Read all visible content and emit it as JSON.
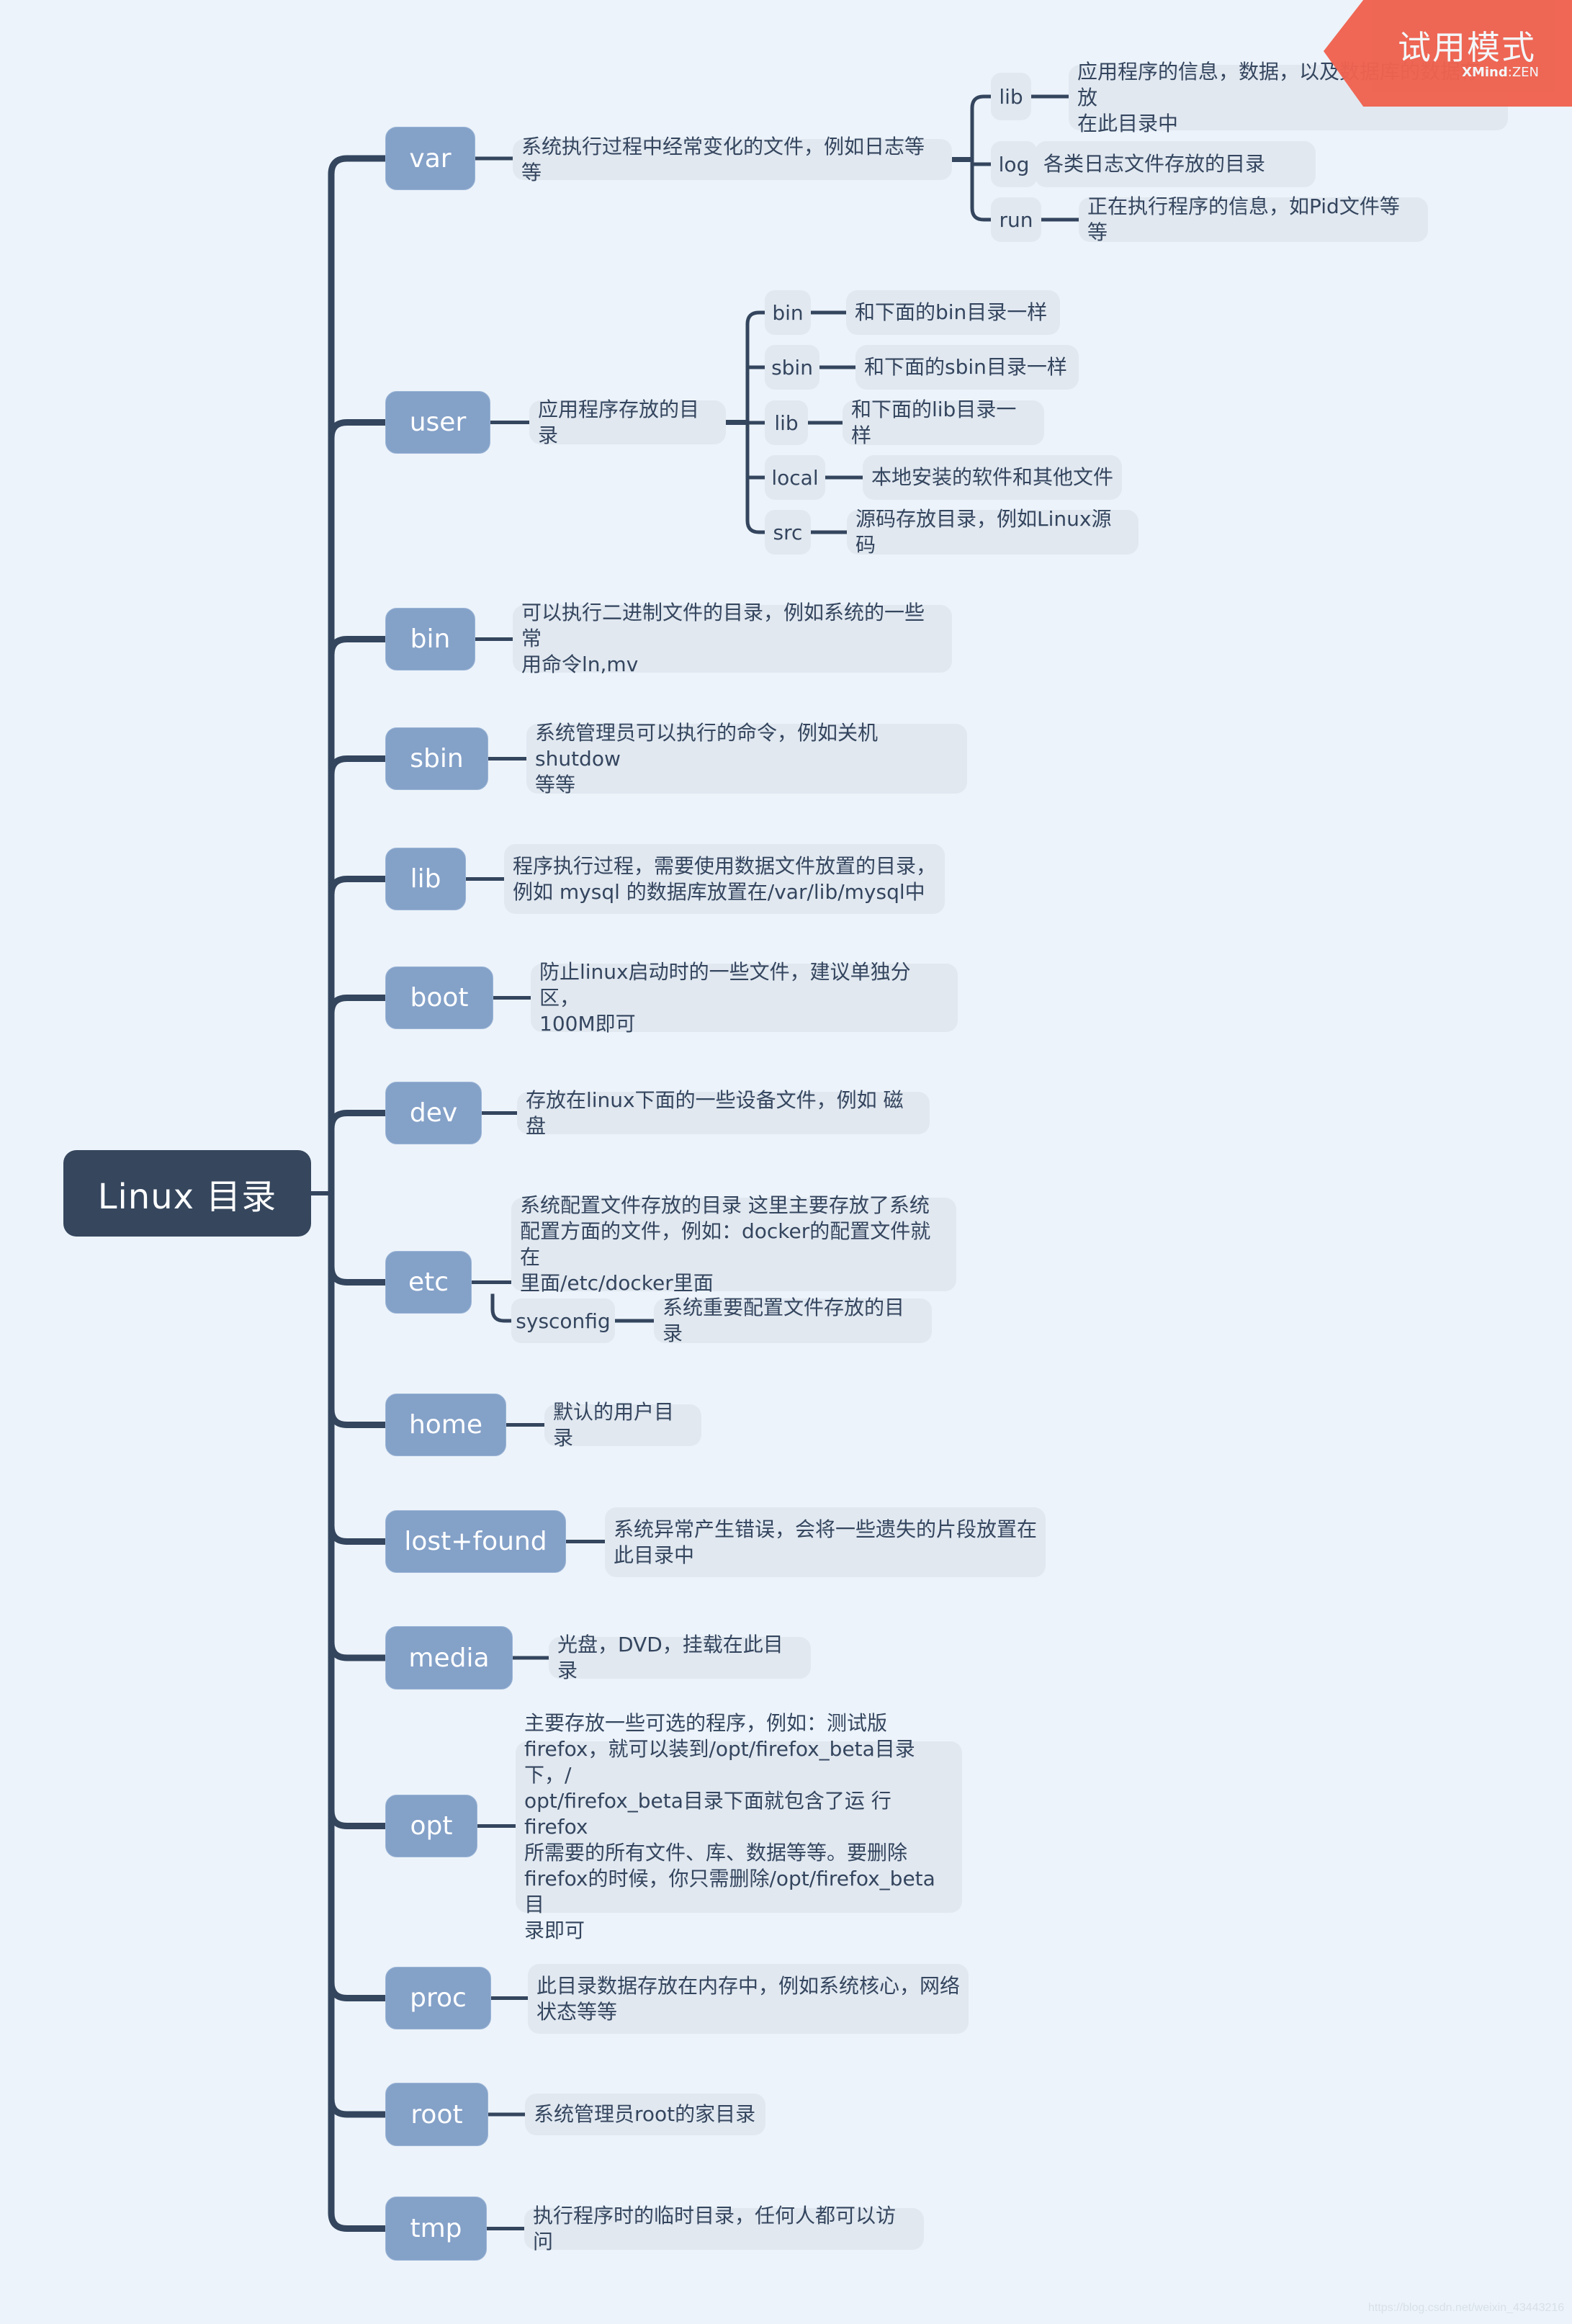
{
  "badge": {
    "title": "试用模式",
    "brand_bold": "XMind",
    "brand_rest": ":ZEN"
  },
  "watermark": "https://blog.csdn.net/weixin_43443216",
  "colors": {
    "background": "#ecf3fa",
    "root": "#35465d",
    "main": "#84a1c8",
    "desc": "#e1e8f0",
    "line": "#34455e",
    "badge": "#ef624f"
  },
  "root": {
    "label": "Linux 目录"
  },
  "topics": [
    {
      "label": "var",
      "desc": "系统执行过程中经常变化的文件，例如日志等等",
      "children": [
        {
          "label": "lib",
          "desc": "应用程序的信息，数据，以及数据库的数据存放\n在此目录中"
        },
        {
          "label": "log",
          "desc": "各类日志文件存放的目录"
        },
        {
          "label": "run",
          "desc": "正在执行程序的信息，如Pid文件等等"
        }
      ]
    },
    {
      "label": "user",
      "desc": "应用程序存放的目录",
      "children": [
        {
          "label": "bin",
          "desc": "和下面的bin目录一样"
        },
        {
          "label": "sbin",
          "desc": "和下面的sbin目录一样"
        },
        {
          "label": "lib",
          "desc": "和下面的lib目录一样"
        },
        {
          "label": "local",
          "desc": "本地安装的软件和其他文件"
        },
        {
          "label": "src",
          "desc": "源码存放目录，例如Linux源码"
        }
      ]
    },
    {
      "label": "bin",
      "desc": "可以执行二进制文件的目录，例如系统的一些常\n用命令ln,mv"
    },
    {
      "label": "sbin",
      "desc": "系统管理员可以执行的命令，例如关机shutdow\n等等"
    },
    {
      "label": "lib",
      "desc": "程序执行过程，需要使用数据文件放置的目录，\n例如 mysql 的数据库放置在/var/lib/mysql中"
    },
    {
      "label": "boot",
      "desc": "防止linux启动时的一些文件，建议单独分区，\n100M即可"
    },
    {
      "label": "dev",
      "desc": "存放在linux下面的一些设备文件，例如 磁盘"
    },
    {
      "label": "etc",
      "desc": "系统配置文件存放的目录 这里主要存放了系统\n配置方面的文件，例如：docker的配置文件就在\n里面/etc/docker里面",
      "children": [
        {
          "label": "sysconfig",
          "desc": "系统重要配置文件存放的目录"
        }
      ]
    },
    {
      "label": "home",
      "desc": "默认的用户目录"
    },
    {
      "label": "lost+found",
      "desc": "系统异常产生错误，会将一些遗失的片段放置在\n此目录中"
    },
    {
      "label": "media",
      "desc": "光盘，DVD，挂载在此目录"
    },
    {
      "label": "opt",
      "desc": "主要存放一些可选的程序，例如：测试版\nfirefox，就可以装到/opt/firefox_beta目录下，/\nopt/firefox_beta目录下面就包含了运 行firefox\n所需要的所有文件、库、数据等等。要删除\nfirefox的时候，你只需删除/opt/firefox_beta目\n录即可"
    },
    {
      "label": "proc",
      "desc": "此目录数据存放在内存中，例如系统核心，网络\n状态等等"
    },
    {
      "label": "root",
      "desc": "系统管理员root的家目录"
    },
    {
      "label": "tmp",
      "desc": "执行程序时的临时目录，任何人都可以访问"
    }
  ]
}
